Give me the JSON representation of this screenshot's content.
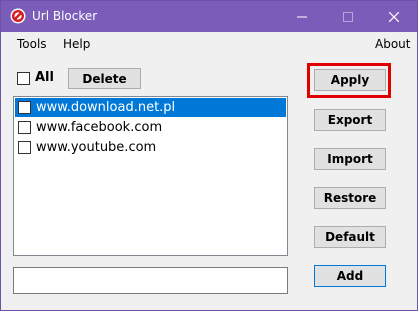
{
  "window": {
    "title": "Url Blocker",
    "app_icon": "no-entry-icon",
    "minimize_icon": "minimize-icon",
    "maximize_icon": "maximize-icon",
    "close_icon": "close-icon"
  },
  "menu": {
    "tools": "Tools",
    "help": "Help",
    "about": "About"
  },
  "toolbar": {
    "all_label": "All",
    "all_checked": false,
    "delete_label": "Delete"
  },
  "url_list": [
    {
      "url": "www.download.net.pl",
      "checked": false,
      "selected": true
    },
    {
      "url": "www.facebook.com",
      "checked": false,
      "selected": false
    },
    {
      "url": "www.youtube.com",
      "checked": false,
      "selected": false
    }
  ],
  "side_buttons": {
    "apply": "Apply",
    "export": "Export",
    "import": "Import",
    "restore": "Restore",
    "default": "Default",
    "add": "Add"
  },
  "new_url_input": {
    "value": "",
    "placeholder": ""
  },
  "colors": {
    "titlebar": "#7b5cb8",
    "selection": "#0078d7",
    "highlight": "#e00000"
  }
}
